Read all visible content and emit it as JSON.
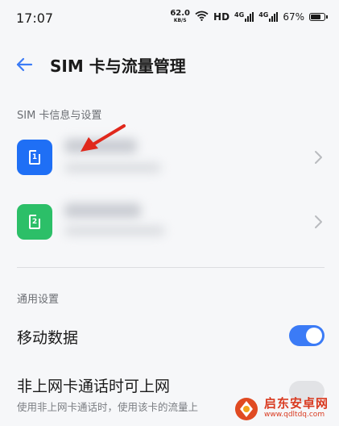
{
  "status_bar": {
    "time": "17:07",
    "net_speed_value": "62.0",
    "net_speed_unit": "KB/S",
    "hd_label": "HD",
    "sig1_label": "4G",
    "sig2_label": "4G",
    "battery_percent": "67%",
    "icons": [
      "wifi-icon",
      "signal-icon",
      "battery-icon"
    ]
  },
  "header": {
    "back_icon": "arrow-left-icon",
    "title": "SIM 卡与流量管理"
  },
  "sim_section": {
    "label": "SIM 卡信息与设置",
    "cards": [
      {
        "badge": "1",
        "color": "#1f6ff5",
        "icon": "sim-card-icon"
      },
      {
        "badge": "2",
        "color": "#2cbf68",
        "icon": "sim-card-icon"
      }
    ]
  },
  "general_section": {
    "label": "通用设置",
    "mobile_data": {
      "title": "移动数据",
      "enabled": true
    },
    "non_data_card_call": {
      "title": "非上网卡通话时可上网",
      "subtitle": "使用非上网卡通话时，使用该卡的流量上"
    }
  },
  "watermark": {
    "name": "启东安卓网",
    "url": "www.qdltdq.com",
    "color": "#d93a20"
  },
  "colors": {
    "accent": "#3b7bf6",
    "annotation_arrow": "#e0281c"
  }
}
